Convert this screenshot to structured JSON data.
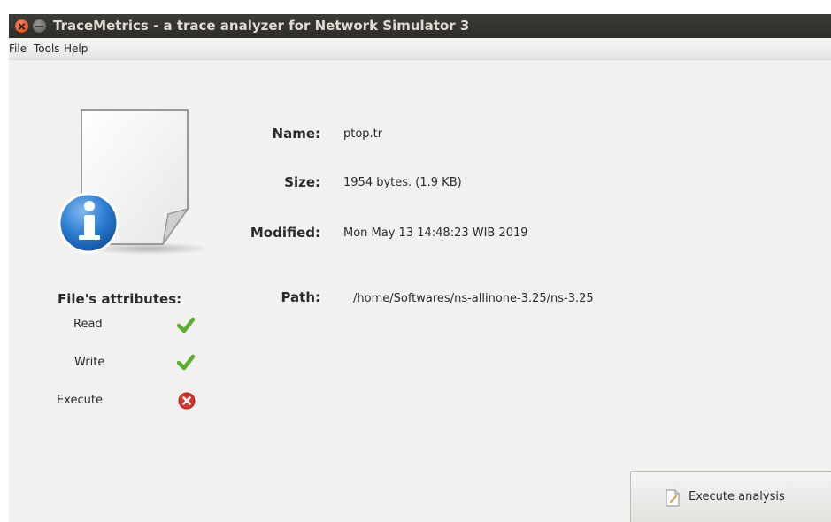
{
  "window": {
    "title": "TraceMetrics - a trace analyzer for Network Simulator 3"
  },
  "menu": {
    "file": "File",
    "tools": "Tools",
    "help": "Help"
  },
  "file_info": {
    "name_label": "Name:",
    "name_value": "ptop.tr",
    "size_label": "Size:",
    "size_value": "1954 bytes. (1.9 KB)",
    "modified_label": "Modified:",
    "modified_value": "Mon May 13 14:48:23 WIB 2019",
    "path_label": "Path:",
    "path_value": "/home/Softwares/ns-allinone-3.25/ns-3.25"
  },
  "attributes": {
    "title": "File's attributes:",
    "items": [
      {
        "label": "Read",
        "status": "yes",
        "icon": "check-icon"
      },
      {
        "label": "Write",
        "status": "yes",
        "icon": "check-icon"
      },
      {
        "label": "Execute",
        "status": "no",
        "icon": "error-icon"
      }
    ]
  },
  "actions": {
    "execute_label": "Execute analysis",
    "execute_icon": "document-edit-icon"
  },
  "colors": {
    "titlebar": "#3c3b37",
    "close_button": "#e1541f",
    "check": "#5cad2f",
    "error": "#d6362a",
    "info_blue": "#1f6fc5",
    "window_bg": "#f2f1f0"
  }
}
